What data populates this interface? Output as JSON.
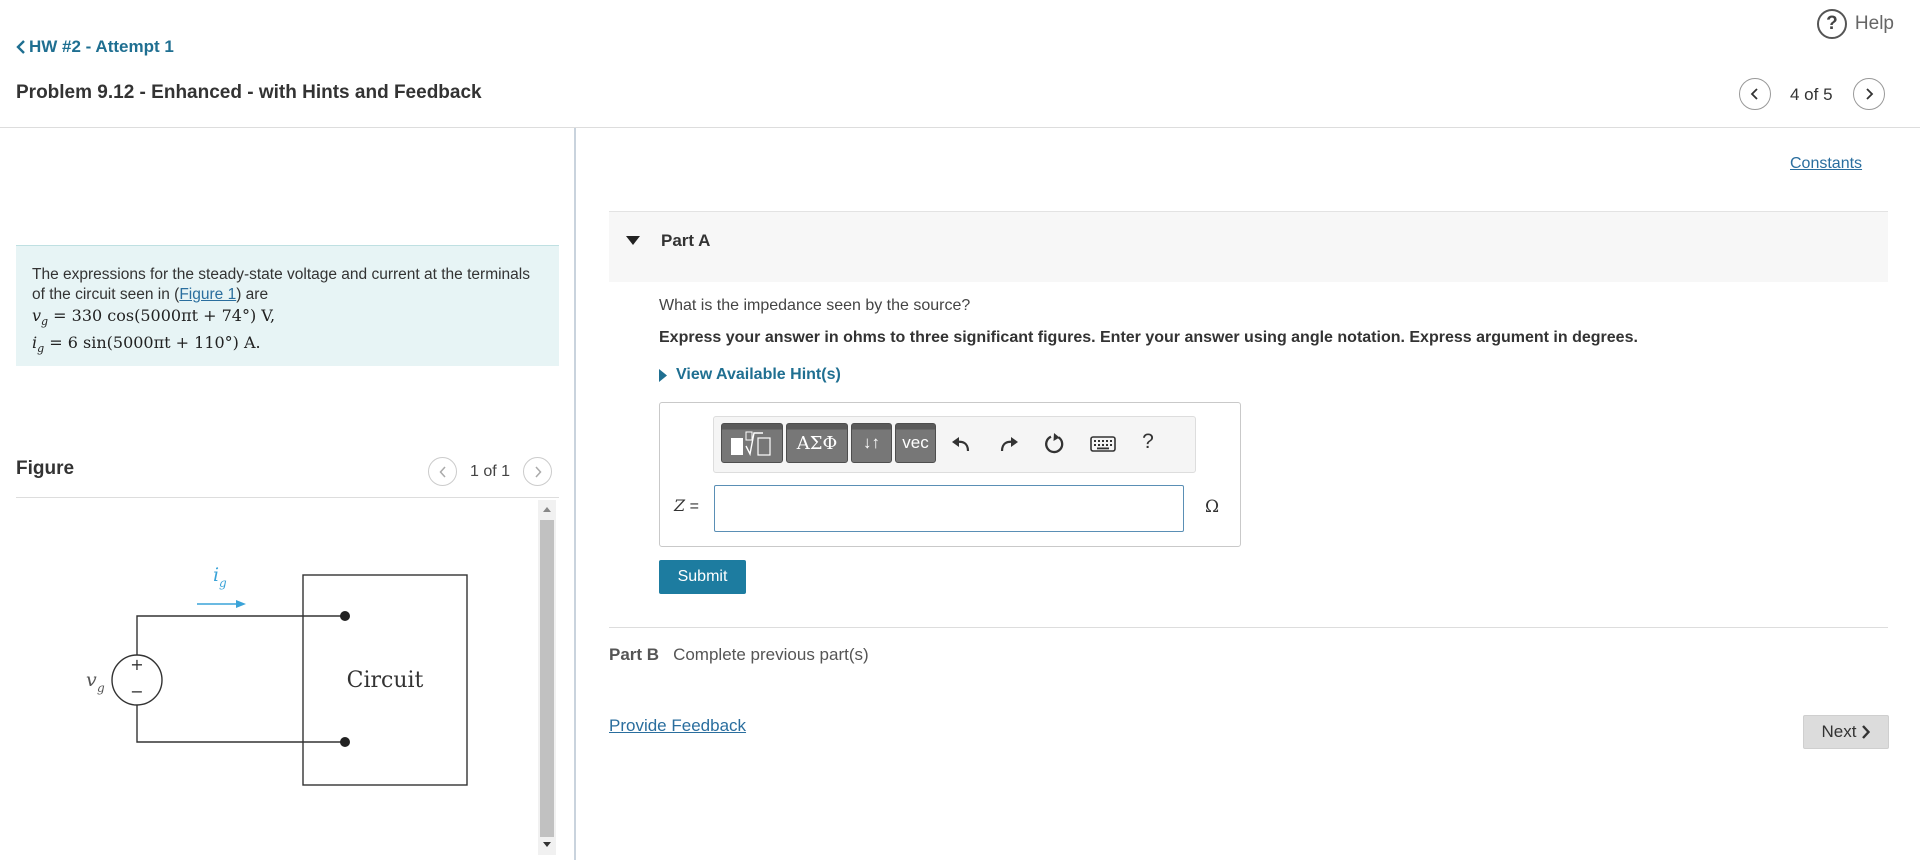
{
  "header": {
    "help_label": "Help",
    "help_icon": "?",
    "back_label": "HW #2 - Attempt 1",
    "problem_title": "Problem 9.12 - Enhanced - with Hints and Feedback",
    "page_indicator": "4 of 5"
  },
  "prompt": {
    "text_before": "The expressions for the steady-state voltage and current at the terminals of the circuit seen in (",
    "figure_link": "Figure 1",
    "text_after": ") are",
    "eq1_lhs": "v",
    "eq1_sub": "g",
    "eq1_rhs": " = 330 cos(5000πt + 74°) V,",
    "eq2_lhs": "i",
    "eq2_sub": "g",
    "eq2_rhs": " = 6 sin(5000πt + 110°) A."
  },
  "figure": {
    "label": "Figure",
    "page_indicator": "1 of 1",
    "circuit_label": "Circuit",
    "current_label": "i",
    "current_sub": "g",
    "source_label": "v",
    "source_sub": "g",
    "plus": "+",
    "minus": "−"
  },
  "right": {
    "constants_label": "Constants",
    "part_a_title": "Part A",
    "question": "What is the impedance seen by the source?",
    "instructions": "Express your answer in ohms to three significant figures. Enter your answer using angle notation. Express argument in degrees.",
    "hint_label": "View Available Hint(s)",
    "toolbar": {
      "greek_label": "ΑΣΦ",
      "arrows_label": "↓↑",
      "vec_label": "vec",
      "help_label": "?"
    },
    "answer_var": "Z",
    "answer_eq": " =",
    "answer_value": "",
    "unit": "Ω",
    "submit_label": "Submit",
    "part_b_label": "Part B",
    "part_b_status": "Complete previous part(s)",
    "feedback_label": "Provide Feedback",
    "next_label": "Next"
  },
  "colors": {
    "accent": "#1d7ca0",
    "link": "#2a6e9e",
    "prompt_bg": "#e7f4f5",
    "figure_current": "#3aa3d8"
  }
}
